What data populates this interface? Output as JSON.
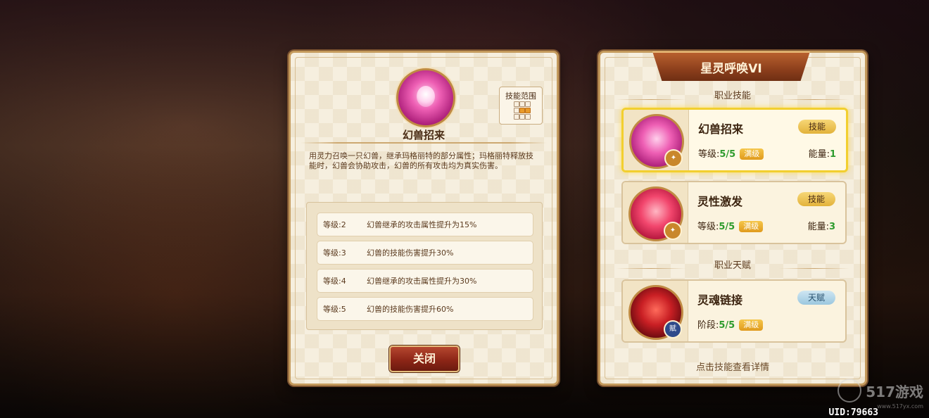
{
  "detail": {
    "skill_name": "幻兽招来",
    "range_label": "技能范围",
    "range_cells": [
      false,
      false,
      false,
      false,
      true,
      true,
      false,
      false,
      false
    ],
    "description": "用灵力召唤一只幻兽，继承玛格丽特的部分属性；玛格丽特释放技能时，幻兽会协助攻击，幻兽的所有攻击均为真实伤害。",
    "levels": [
      {
        "level": "等级:2",
        "effect": "幻兽继承的攻击属性提升为15%"
      },
      {
        "level": "等级:3",
        "effect": "幻兽的技能伤害提升30%"
      },
      {
        "level": "等级:4",
        "effect": "幻兽继承的攻击属性提升为30%"
      },
      {
        "level": "等级:5",
        "effect": "幻兽的技能伤害提升60%"
      }
    ],
    "close_label": "关闭"
  },
  "class_panel": {
    "title": "星灵呼唤VI",
    "section_skills": "职业技能",
    "section_talents": "职业天赋",
    "skills": [
      {
        "name": "幻兽招来",
        "tag": "技能",
        "level_label": "等级:",
        "level_value": "5/5",
        "max_label": "满级",
        "energy_label": "能量:",
        "energy_value": "1",
        "icon": "phantom-beast-icon"
      },
      {
        "name": "灵性激发",
        "tag": "技能",
        "level_label": "等级:",
        "level_value": "5/5",
        "max_label": "满级",
        "energy_label": "能量:",
        "energy_value": "3",
        "icon": "spirit-burst-icon"
      }
    ],
    "talent": {
      "name": "灵魂链接",
      "tag": "天赋",
      "badge": "赋",
      "level_label": "阶段:",
      "level_value": "5/5",
      "max_label": "满级",
      "icon": "soul-link-icon"
    },
    "hint": "点击技能查看详情"
  },
  "footer": {
    "uid": "UID:79663",
    "watermark": "517游戏",
    "watermark_sub": "www.517yx.com"
  },
  "colors": {
    "panel_bg": "#f6efdf",
    "panel_border": "#c49a5c",
    "close_button": "#8d2617",
    "selected_highlight": "#f2cf2f",
    "value_green": "#2d9b2d"
  }
}
